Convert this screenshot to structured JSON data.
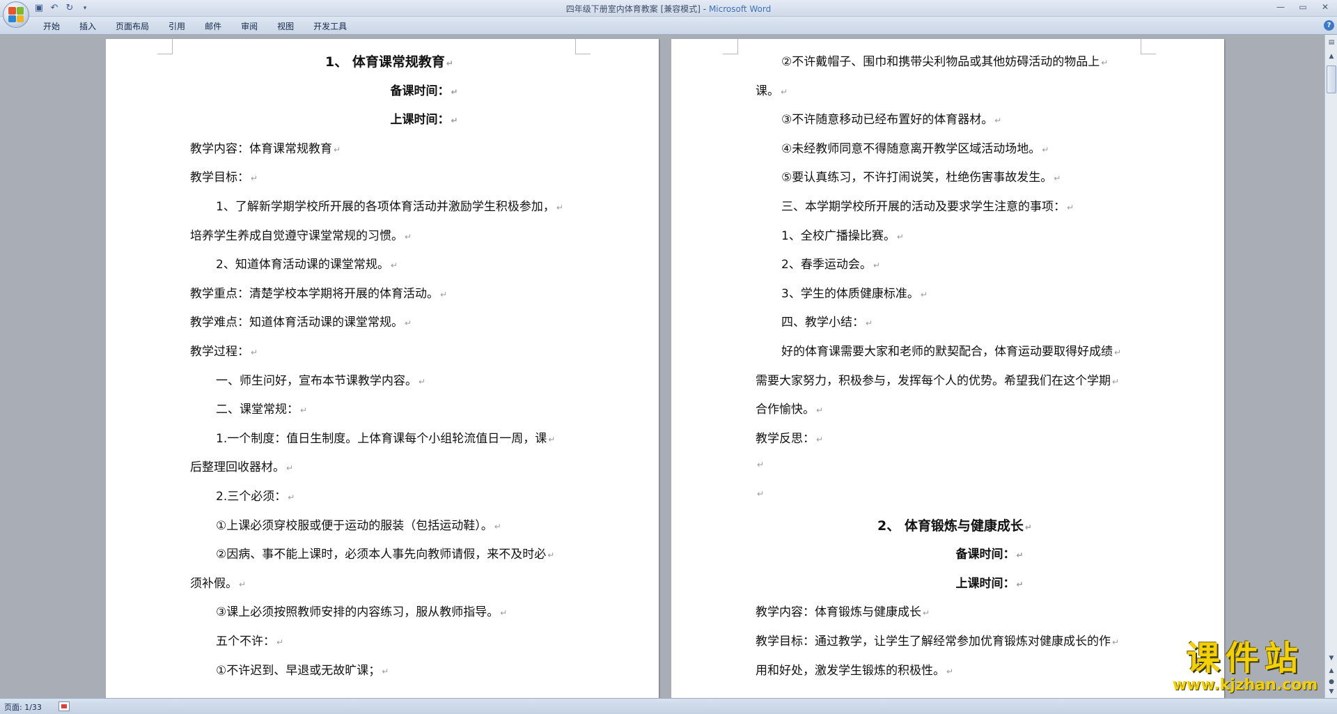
{
  "window": {
    "title_doc": "四年级下册室内体育教案 [兼容模式] -",
    "title_app": "Microsoft Word"
  },
  "qat": {
    "save_icon": "save-icon",
    "undo_icon": "undo-icon",
    "redo_icon": "redo-icon",
    "customize_icon": "chevron-down-icon"
  },
  "ribbon": {
    "tabs": [
      "开始",
      "插入",
      "页面布局",
      "引用",
      "邮件",
      "审阅",
      "视图",
      "开发工具"
    ]
  },
  "status": {
    "page": "页面: 1/33"
  },
  "pages": {
    "left": [
      {
        "text": "1、   体育课常规教育",
        "style": "heading"
      },
      {
        "text": "备课时间：",
        "style": "subheading"
      },
      {
        "text": "上课时间：",
        "style": "subheading"
      },
      {
        "text": "教学内容：体育课常规教育",
        "style": "normal"
      },
      {
        "text": "教学目标：",
        "style": "normal"
      },
      {
        "text": "1、了解新学期学校所开展的各项体育活动并激励学生积极参加，",
        "style": "normal"
      },
      {
        "text": "培养学生养成自觉遵守课堂常规的习惯。",
        "style": "normal"
      },
      {
        "text": "2、知道体育活动课的课堂常规。",
        "style": "normal"
      },
      {
        "text": "教学重点：清楚学校本学期将开展的体育活动。",
        "style": "normal"
      },
      {
        "text": "教学难点：知道体育活动课的课堂常规。",
        "style": "normal"
      },
      {
        "text": "教学过程：",
        "style": "normal"
      },
      {
        "text": "一、师生问好，宣布本节课教学内容。",
        "style": "normal"
      },
      {
        "text": "二、课堂常规：",
        "style": "normal"
      },
      {
        "text": "1.一个制度：值日生制度。上体育课每个小组轮流值日一周，课",
        "style": "normal"
      },
      {
        "text": "后整理回收器材。",
        "style": "normal"
      },
      {
        "text": "2.三个必须：",
        "style": "normal"
      },
      {
        "text": "①上课必须穿校服或便于运动的服装（包括运动鞋）。",
        "style": "normal"
      },
      {
        "text": "②因病、事不能上课时，必须本人事先向教师请假，来不及时必",
        "style": "normal"
      },
      {
        "text": "须补假。",
        "style": "normal"
      },
      {
        "text": "③课上必须按照教师安排的内容练习，服从教师指导。",
        "style": "normal"
      },
      {
        "text": "五个不许：",
        "style": "normal"
      },
      {
        "text": "①不许迟到、早退或无故旷课；",
        "style": "normal"
      }
    ],
    "right": [
      {
        "text": "②不许戴帽子、围巾和携带尖利物品或其他妨碍活动的物品上",
        "style": "normal"
      },
      {
        "text": "课。",
        "style": "normal"
      },
      {
        "text": "③不许随意移动已经布置好的体育器材。",
        "style": "normal"
      },
      {
        "text": "④未经教师同意不得随意离开教学区域活动场地。",
        "style": "normal"
      },
      {
        "text": "⑤要认真练习，不许打闹说笑，杜绝伤害事故发生。",
        "style": "normal"
      },
      {
        "text": "三、本学期学校所开展的活动及要求学生注意的事项：",
        "style": "normal"
      },
      {
        "text": "1、全校广播操比赛。",
        "style": "normal"
      },
      {
        "text": "2、春季运动会。",
        "style": "normal"
      },
      {
        "text": "3、学生的体质健康标准。",
        "style": "normal"
      },
      {
        "text": "四、教学小结：",
        "style": "normal"
      },
      {
        "text": "好的体育课需要大家和老师的默契配合，体育运动要取得好成绩",
        "style": "normal"
      },
      {
        "text": "需要大家努力，积极参与，发挥每个人的优势。希望我们在这个学期",
        "style": "normal"
      },
      {
        "text": "合作愉快。",
        "style": "normal"
      },
      {
        "text": "教学反思：",
        "style": "normal"
      },
      {
        "text": "",
        "style": "normal"
      },
      {
        "text": "",
        "style": "normal"
      },
      {
        "text": "2、   体育锻炼与健康成长",
        "style": "heading"
      },
      {
        "text": "备课时间：",
        "style": "subheading"
      },
      {
        "text": "上课时间：",
        "style": "subheading"
      },
      {
        "text": "教学内容：体育锻炼与健康成长",
        "style": "normal"
      },
      {
        "text": "教学目标：通过教学，让学生了解经常参加优育锻炼对健康成长的作",
        "style": "normal"
      },
      {
        "text": "用和好处，激发学生锻炼的积极性。",
        "style": "normal"
      }
    ]
  },
  "watermark": {
    "cn": "课件站",
    "url": "www.kjzhan.com"
  },
  "colors": {
    "accent": "#3f71b8",
    "watermark": "#f5d000"
  }
}
